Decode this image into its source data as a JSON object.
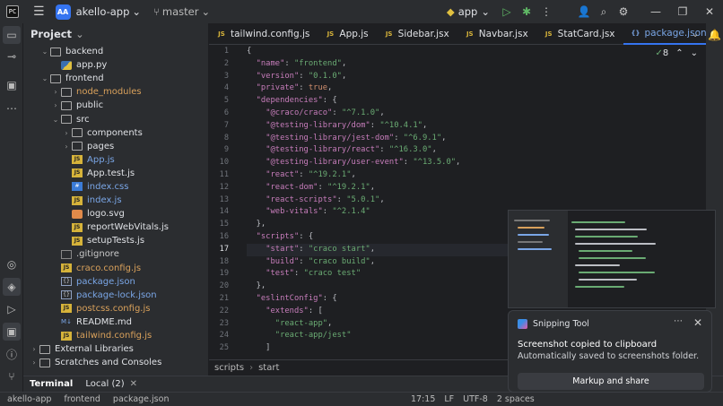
{
  "titlebar": {
    "project_badge": "AA",
    "project_name": "akello-app",
    "branch": "master",
    "run_config": "app"
  },
  "project_panel": {
    "title": "Project",
    "tree": [
      {
        "depth": 2,
        "arrow": "v",
        "icon": "folder",
        "label": "backend",
        "color": "default"
      },
      {
        "depth": 3,
        "arrow": "",
        "icon": "py",
        "label": "app.py",
        "color": "default"
      },
      {
        "depth": 2,
        "arrow": "v",
        "icon": "folder",
        "label": "frontend",
        "color": "default"
      },
      {
        "depth": 3,
        "arrow": ">",
        "icon": "folder",
        "label": "node_modules",
        "color": "orange"
      },
      {
        "depth": 3,
        "arrow": ">",
        "icon": "folder",
        "label": "public",
        "color": "default"
      },
      {
        "depth": 3,
        "arrow": "v",
        "icon": "folder",
        "label": "src",
        "color": "default"
      },
      {
        "depth": 4,
        "arrow": ">",
        "icon": "folder",
        "label": "components",
        "color": "default"
      },
      {
        "depth": 4,
        "arrow": ">",
        "icon": "folder",
        "label": "pages",
        "color": "default"
      },
      {
        "depth": 4,
        "arrow": "",
        "icon": "js",
        "label": "App.js",
        "color": "blue"
      },
      {
        "depth": 4,
        "arrow": "",
        "icon": "js",
        "label": "App.test.js",
        "color": "default"
      },
      {
        "depth": 4,
        "arrow": "",
        "icon": "css",
        "label": "index.css",
        "color": "blue"
      },
      {
        "depth": 4,
        "arrow": "",
        "icon": "js",
        "label": "index.js",
        "color": "blue"
      },
      {
        "depth": 4,
        "arrow": "",
        "icon": "svg",
        "label": "logo.svg",
        "color": "default"
      },
      {
        "depth": 4,
        "arrow": "",
        "icon": "js",
        "label": "reportWebVitals.js",
        "color": "default"
      },
      {
        "depth": 4,
        "arrow": "",
        "icon": "js",
        "label": "setupTests.js",
        "color": "default"
      },
      {
        "depth": 3,
        "arrow": "",
        "icon": "txt",
        "label": ".gitignore",
        "color": "ignore"
      },
      {
        "depth": 3,
        "arrow": "",
        "icon": "js",
        "label": "craco.config.js",
        "color": "orange"
      },
      {
        "depth": 3,
        "arrow": "",
        "icon": "json",
        "label": "package.json",
        "color": "blue"
      },
      {
        "depth": 3,
        "arrow": "",
        "icon": "json",
        "label": "package-lock.json",
        "color": "blue"
      },
      {
        "depth": 3,
        "arrow": "",
        "icon": "js",
        "label": "postcss.config.js",
        "color": "orange"
      },
      {
        "depth": 3,
        "arrow": "",
        "icon": "md",
        "label": "README.md",
        "color": "default"
      },
      {
        "depth": 3,
        "arrow": "",
        "icon": "js",
        "label": "tailwind.config.js",
        "color": "orange"
      },
      {
        "depth": 1,
        "arrow": ">",
        "icon": "folder",
        "label": "External Libraries",
        "color": "default"
      },
      {
        "depth": 1,
        "arrow": ">",
        "icon": "folder",
        "label": "Scratches and Consoles",
        "color": "default"
      }
    ]
  },
  "tabs": [
    {
      "icon": "JS",
      "label": "tailwind.config.js",
      "active": false
    },
    {
      "icon": "JS",
      "label": "App.js",
      "active": false
    },
    {
      "icon": "JS",
      "label": "Sidebar.jsx",
      "active": false
    },
    {
      "icon": "JS",
      "label": "Navbar.jsx",
      "active": false
    },
    {
      "icon": "JS",
      "label": "StatCard.jsx",
      "active": false
    },
    {
      "icon": "{}",
      "label": "package.json",
      "active": true
    }
  ],
  "inspections": {
    "check_count": "8"
  },
  "editor": {
    "line_numbers": [
      "1",
      "2",
      "3",
      "4",
      "5",
      "6",
      "7",
      "8",
      "9",
      "10",
      "11",
      "12",
      "13",
      "14",
      "15",
      "16",
      "17",
      "18",
      "19",
      "20",
      "21",
      "22",
      "23",
      "24",
      "25"
    ],
    "lines": [
      "{",
      "  \"name\": \"frontend\",",
      "  \"version\": \"0.1.0\",",
      "  \"private\": true,",
      "  \"dependencies\": {",
      "    \"@craco/craco\": \"^7.1.0\",",
      "    \"@testing-library/dom\": \"^10.4.1\",",
      "    \"@testing-library/jest-dom\": \"^6.9.1\",",
      "    \"@testing-library/react\": \"^16.3.0\",",
      "    \"@testing-library/user-event\": \"^13.5.0\",",
      "    \"react\": \"^19.2.1\",",
      "    \"react-dom\": \"^19.2.1\",",
      "    \"react-scripts\": \"5.0.1\",",
      "    \"web-vitals\": \"^2.1.4\"",
      "  },",
      "  \"scripts\": {",
      "    \"start\": \"craco start\",",
      "    \"build\": \"craco build\",",
      "    \"test\": \"craco test\"",
      "  },",
      "  \"eslintConfig\": {",
      "    \"extends\": [",
      "      \"react-app\",",
      "      \"react-app/jest\"",
      "    ]"
    ],
    "current_line_index": 16,
    "breadcrumb": [
      "scripts",
      "start"
    ]
  },
  "bottom_tabs": [
    {
      "label": "Terminal",
      "active": true
    },
    {
      "label": "Local (2)",
      "active": false
    }
  ],
  "status": {
    "path": [
      "akello-app",
      "frontend",
      "package.json"
    ],
    "position": "17:15",
    "line_sep": "LF",
    "encoding": "UTF-8",
    "indent": "2 spaces"
  },
  "toast": {
    "app": "Snipping Tool",
    "title": "Screenshot copied to clipboard",
    "body": "Automatically saved to screenshots folder.",
    "button": "Markup and share"
  }
}
